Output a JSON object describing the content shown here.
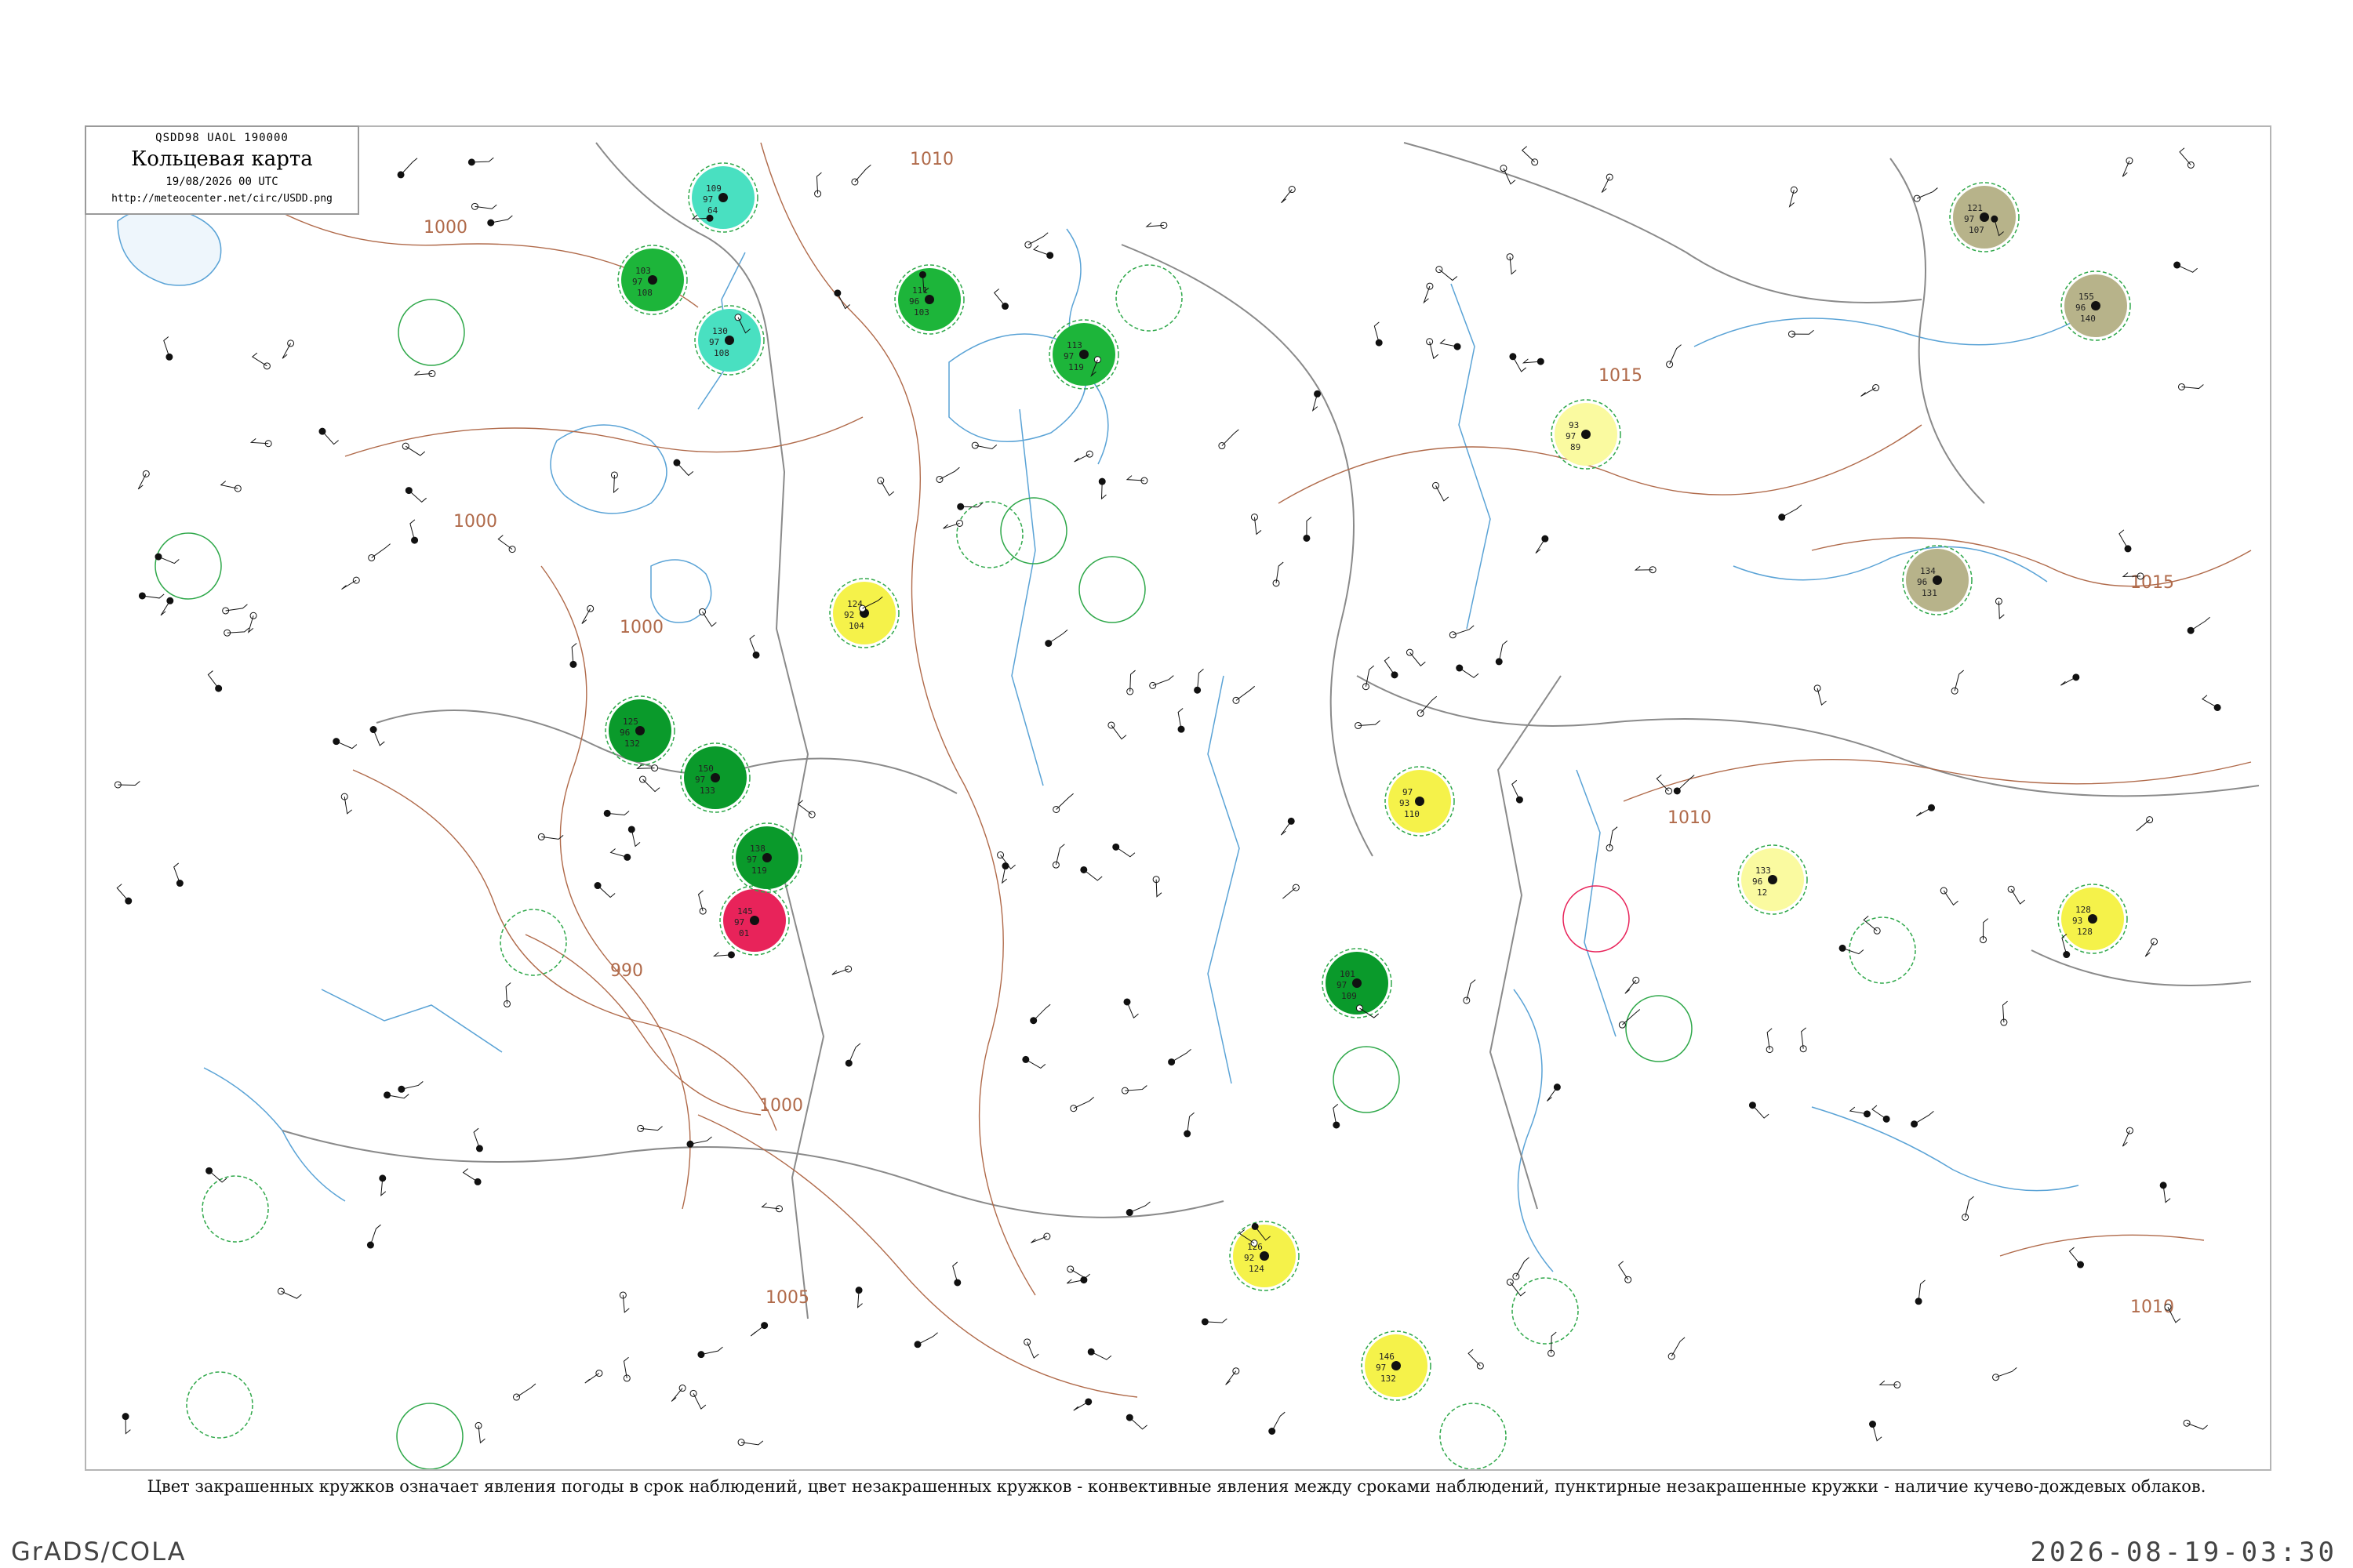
{
  "header": {
    "code_line": "QSDD98  UAOL  190000",
    "title": "Кольцевая карта",
    "date": "19/08/2026 00 UTC",
    "url": "http://meteocenter.net/circ/USDD.png"
  },
  "isobar_labels": [
    "1010",
    "1000",
    "1000",
    "1000",
    "990",
    "1000",
    "1005",
    "1015",
    "1015",
    "1010",
    "1010"
  ],
  "legend_caption": "Цвет закрашенных кружков означает явления погоды в срок наблюдений, цвет незакрашенных кружков - конвективные явления между сроками наблюдений, пунктирные незакрашенные кружки - наличие кучево-дождевых облаков.",
  "footer": {
    "left": "GrADS/COLA",
    "right": "2026-08-19-03:30"
  },
  "colors": {
    "rain": "#1db53a",
    "showers": "#0a9a2b",
    "fog_mist": "#f5f24a",
    "haze_light": "#fafaa0",
    "thunder": "#e8235a",
    "drizzle": "#49e0c1",
    "dust": "#b7b38a",
    "cb_outline": "#2fa84a",
    "isobar": "#a0522d",
    "water": "#5aa3d6",
    "border": "#8a8a8a"
  },
  "stations": [
    {
      "kind": "rain",
      "v1": "103",
      "v2": "97",
      "v3": "108"
    },
    {
      "kind": "rain",
      "v1": "111",
      "v2": "96",
      "v3": "103"
    },
    {
      "kind": "drizzle",
      "v1": "109",
      "v2": "97",
      "v3": "64"
    },
    {
      "kind": "drizzle",
      "v1": "130",
      "v2": "97",
      "v3": "108"
    },
    {
      "kind": "rain",
      "v1": "113",
      "v2": "97",
      "v3": "119"
    },
    {
      "kind": "showers",
      "v1": "125",
      "v2": "96",
      "v3": "132"
    },
    {
      "kind": "showers",
      "v1": "150",
      "v2": "97",
      "v3": "133"
    },
    {
      "kind": "thunder",
      "v1": "145",
      "v2": "97",
      "v3": "01"
    },
    {
      "kind": "fog_mist",
      "v1": "124",
      "v2": "92",
      "v3": "104"
    },
    {
      "kind": "fog_mist",
      "v1": "97",
      "v2": "93",
      "v3": "110"
    },
    {
      "kind": "fog_mist",
      "v1": "126",
      "v2": "92",
      "v3": "124"
    },
    {
      "kind": "fog_mist",
      "v1": "146",
      "v2": "97",
      "v3": "132"
    },
    {
      "kind": "haze_light",
      "v1": "93",
      "v2": "97",
      "v3": "89"
    },
    {
      "kind": "haze_light",
      "v1": "133",
      "v2": "96",
      "v3": "12"
    },
    {
      "kind": "dust",
      "v1": "121",
      "v2": "97",
      "v3": "107"
    },
    {
      "kind": "dust",
      "v1": "155",
      "v2": "96",
      "v3": "140"
    },
    {
      "kind": "dust",
      "v1": "134",
      "v2": "96",
      "v3": "131"
    },
    {
      "kind": "fog_mist",
      "v1": "128",
      "v2": "93",
      "v3": "128"
    },
    {
      "kind": "showers",
      "v1": "101",
      "v2": "97",
      "v3": "109"
    },
    {
      "kind": "showers",
      "v1": "138",
      "v2": "97",
      "v3": "119"
    }
  ]
}
